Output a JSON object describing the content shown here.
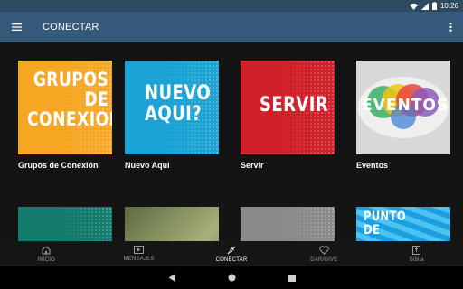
{
  "status_bar": {
    "time": "10:26"
  },
  "app_bar": {
    "title": "CONECTAR"
  },
  "cards": [
    {
      "tile_text": "GRUPOS DE CONEXION",
      "label": "Grupos de Conexión",
      "color": "#f5a623"
    },
    {
      "tile_text": "NUEVO AQUI?",
      "label": "Nuevo Aqui",
      "color": "#1ba3d6"
    },
    {
      "tile_text": "SERVIR",
      "label": "Servir",
      "color": "#d0202a"
    },
    {
      "tile_text": "EVENTOS",
      "label": "Eventos",
      "color": "#d8d8d8"
    }
  ],
  "partial_cards": [
    {
      "color": "#137a6e"
    },
    {
      "color": "#7a8a55"
    },
    {
      "color": "#8a8a8a"
    },
    {
      "tile_text": "PUNTO DE",
      "color": "#1c9fe0"
    }
  ],
  "bottom_nav": [
    {
      "label": "INICIO",
      "icon": "home-icon"
    },
    {
      "label": "MENSAJES",
      "icon": "video-icon"
    },
    {
      "label": "CONECTAR",
      "icon": "connect-icon",
      "active": true
    },
    {
      "label": "DAR/GIVE",
      "icon": "heart-icon"
    },
    {
      "label": "Biblia",
      "icon": "bible-icon"
    }
  ],
  "colors": {
    "status_bar": "#2e4a5f",
    "app_bar": "#36597a",
    "background": "#141414"
  }
}
